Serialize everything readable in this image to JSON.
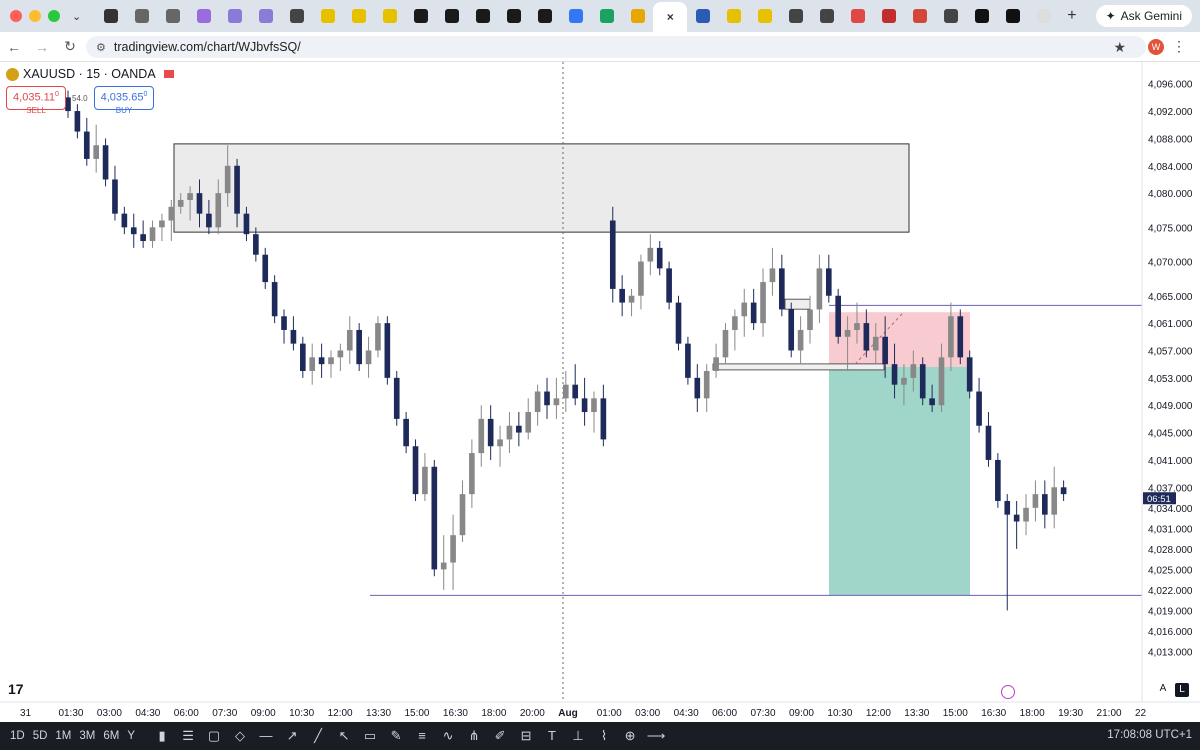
{
  "browser": {
    "url": "tradingview.com/chart/WJbvfsSQ/",
    "ask_gemini": "Ask Gemini",
    "profile_initial": "W",
    "tabs": [
      {
        "name": "tab-copilot",
        "color": "#333"
      },
      {
        "name": "tab-1",
        "color": "#666"
      },
      {
        "name": "tab-2",
        "color": "#666"
      },
      {
        "name": "tab-3",
        "color": "#9a6adf"
      },
      {
        "name": "tab-4",
        "color": "#8a7bd8"
      },
      {
        "name": "tab-5",
        "color": "#8a7bd8"
      },
      {
        "name": "tab-chrome-1",
        "color": "#444"
      },
      {
        "name": "tab-ex-1",
        "color": "#e7c100"
      },
      {
        "name": "tab-ex-2",
        "color": "#e7c100"
      },
      {
        "name": "tab-ex-3",
        "color": "#e7c100"
      },
      {
        "name": "tab-p-1",
        "color": "#1a1a1a"
      },
      {
        "name": "tab-p-2",
        "color": "#1a1a1a"
      },
      {
        "name": "tab-p-3",
        "color": "#1a1a1a"
      },
      {
        "name": "tab-p-4",
        "color": "#1a1a1a"
      },
      {
        "name": "tab-p-5",
        "color": "#1a1a1a"
      },
      {
        "name": "tab-play-1",
        "color": "#3477f5"
      },
      {
        "name": "tab-play-2",
        "color": "#1aa260"
      },
      {
        "name": "tab-bell",
        "color": "#e6a800"
      },
      {
        "name": "tab-tradingview-active",
        "color": "#fff"
      },
      {
        "name": "tab-chart",
        "color": "#2c5bb5"
      },
      {
        "name": "tab-ex-4",
        "color": "#e7c100"
      },
      {
        "name": "tab-ex-5",
        "color": "#e7c100"
      },
      {
        "name": "tab-chrome-2",
        "color": "#444"
      },
      {
        "name": "tab-chrome-3",
        "color": "#444"
      },
      {
        "name": "tab-d",
        "color": "#e04848"
      },
      {
        "name": "tab-x",
        "color": "#c02e2e"
      },
      {
        "name": "tab-gmail",
        "color": "#d44638"
      },
      {
        "name": "tab-chrome-4",
        "color": "#444"
      },
      {
        "name": "tab-black-1",
        "color": "#111"
      },
      {
        "name": "tab-black-2",
        "color": "#111"
      },
      {
        "name": "tab-fn",
        "color": "#ddd"
      }
    ]
  },
  "symbol": {
    "name": "XAUUSD · 15 · OANDA",
    "sell_price": "4,035.11",
    "sell_sup": "0",
    "sell_label": "SELL",
    "buy_price": "4,035.65",
    "buy_sup": "0",
    "buy_label": "BUY",
    "spread": "54.0"
  },
  "price_scale": {
    "labels": [
      "4,096.000",
      "4,092.000",
      "4,088.000",
      "4,084.000",
      "4,080.000",
      "4,075.000",
      "4,070.000",
      "4,065.000",
      "4,061.000",
      "4,057.000",
      "4,053.000",
      "4,049.000",
      "4,045.000",
      "4,041.000",
      "4,037.000",
      "4,034.000",
      "4,031.000",
      "4,028.000",
      "4,025.000",
      "4,022.000",
      "4,019.000",
      "4,016.000",
      "4,013.000"
    ],
    "countdown": "06:51"
  },
  "time_axis": {
    "labels": [
      "31",
      "01:30",
      "03:00",
      "04:30",
      "06:00",
      "07:30",
      "09:00",
      "10:30",
      "12:00",
      "13:30",
      "15:00",
      "16:30",
      "18:00",
      "20:00",
      "Aug",
      "01:00",
      "03:00",
      "04:30",
      "06:00",
      "07:30",
      "09:00",
      "10:30",
      "12:00",
      "13:30",
      "15:00",
      "16:30",
      "18:00",
      "19:30",
      "21:00",
      "22"
    ]
  },
  "chart_data": {
    "type": "candlestick",
    "symbol": "XAUUSD",
    "interval": "15",
    "broker": "OANDA",
    "ylim": [
      4010,
      4098
    ],
    "up_color": "#888888",
    "down_color": "#1e2a5a",
    "zones": {
      "supply_box": {
        "y_top": 4087.2,
        "y_bottom": 4074.3,
        "color": "#e6e6e6"
      },
      "stop_zone": {
        "y_top": 4062.6,
        "y_bottom": 4054.6,
        "color": "#f5b5bd"
      },
      "target_zone": {
        "y_top": 4054.6,
        "y_bottom": 4021.2,
        "color": "#8fcfbf"
      },
      "support_line": 4021.2,
      "resistance_line": 4063.6
    },
    "candles": [
      [
        4094,
        4095,
        4091,
        4092
      ],
      [
        4092,
        4093,
        4088,
        4089
      ],
      [
        4089,
        4091,
        4084,
        4085
      ],
      [
        4085,
        4090,
        4083,
        4087
      ],
      [
        4087,
        4088,
        4081,
        4082
      ],
      [
        4082,
        4084,
        4076,
        4077
      ],
      [
        4077,
        4078,
        4074,
        4075
      ],
      [
        4075,
        4077,
        4072,
        4074
      ],
      [
        4074,
        4076,
        4072,
        4073
      ],
      [
        4073,
        4076,
        4072,
        4075
      ],
      [
        4075,
        4077,
        4073,
        4076
      ],
      [
        4076,
        4079,
        4073,
        4078
      ],
      [
        4078,
        4080,
        4077,
        4079
      ],
      [
        4079,
        4081,
        4076,
        4080
      ],
      [
        4080,
        4082,
        4075,
        4077
      ],
      [
        4077,
        4079,
        4074,
        4075
      ],
      [
        4075,
        4082,
        4074,
        4080
      ],
      [
        4080,
        4087,
        4078,
        4084
      ],
      [
        4084,
        4085,
        4075,
        4077
      ],
      [
        4077,
        4078,
        4073,
        4074
      ],
      [
        4074,
        4075,
        4070,
        4071
      ],
      [
        4071,
        4072,
        4066,
        4067
      ],
      [
        4067,
        4068,
        4061,
        4062
      ],
      [
        4062,
        4063,
        4058,
        4060
      ],
      [
        4060,
        4062,
        4057,
        4058
      ],
      [
        4058,
        4059,
        4053,
        4054
      ],
      [
        4054,
        4058,
        4052,
        4056
      ],
      [
        4056,
        4058,
        4053,
        4055
      ],
      [
        4055,
        4057,
        4053,
        4056
      ],
      [
        4056,
        4058,
        4054,
        4057
      ],
      [
        4057,
        4062,
        4055,
        4060
      ],
      [
        4060,
        4061,
        4054,
        4055
      ],
      [
        4055,
        4059,
        4053,
        4057
      ],
      [
        4057,
        4062,
        4056,
        4061
      ],
      [
        4061,
        4062,
        4052,
        4053
      ],
      [
        4053,
        4054,
        4046,
        4047
      ],
      [
        4047,
        4048,
        4042,
        4043
      ],
      [
        4043,
        4044,
        4035,
        4036
      ],
      [
        4036,
        4042,
        4035,
        4040
      ],
      [
        4040,
        4041,
        4024,
        4025
      ],
      [
        4025,
        4030,
        4022,
        4026
      ],
      [
        4026,
        4033,
        4022,
        4030
      ],
      [
        4030,
        4038,
        4029,
        4036
      ],
      [
        4036,
        4044,
        4034,
        4042
      ],
      [
        4042,
        4049,
        4040,
        4047
      ],
      [
        4047,
        4049,
        4041,
        4043
      ],
      [
        4043,
        4046,
        4040,
        4044
      ],
      [
        4044,
        4048,
        4042,
        4046
      ],
      [
        4046,
        4048,
        4043,
        4045
      ],
      [
        4045,
        4050,
        4044,
        4048
      ],
      [
        4048,
        4052,
        4046,
        4051
      ],
      [
        4051,
        4053,
        4047,
        4049
      ],
      [
        4049,
        4053,
        4047,
        4050
      ],
      [
        4050,
        4054,
        4048,
        4052
      ],
      [
        4052,
        4055,
        4049,
        4050
      ],
      [
        4050,
        4053,
        4046,
        4048
      ],
      [
        4048,
        4051,
        4045,
        4050
      ],
      [
        4050,
        4052,
        4043,
        4044
      ],
      [
        4076,
        4078,
        4064,
        4066
      ],
      [
        4066,
        4068,
        4062,
        4064
      ],
      [
        4064,
        4066,
        4062,
        4065
      ],
      [
        4065,
        4071,
        4063,
        4070
      ],
      [
        4070,
        4074,
        4068,
        4072
      ],
      [
        4072,
        4073,
        4068,
        4069
      ],
      [
        4069,
        4070,
        4063,
        4064
      ],
      [
        4064,
        4065,
        4057,
        4058
      ],
      [
        4058,
        4059,
        4052,
        4053
      ],
      [
        4053,
        4055,
        4048,
        4050
      ],
      [
        4050,
        4055,
        4048,
        4054
      ],
      [
        4054,
        4058,
        4053,
        4056
      ],
      [
        4056,
        4061,
        4055,
        4060
      ],
      [
        4060,
        4063,
        4057,
        4062
      ],
      [
        4062,
        4066,
        4059,
        4064
      ],
      [
        4064,
        4066,
        4060,
        4061
      ],
      [
        4061,
        4069,
        4059,
        4067
      ],
      [
        4067,
        4072,
        4065,
        4069
      ],
      [
        4069,
        4071,
        4062,
        4063
      ],
      [
        4063,
        4064,
        4056,
        4057
      ],
      [
        4057,
        4062,
        4055,
        4060
      ],
      [
        4060,
        4065,
        4058,
        4063
      ],
      [
        4063,
        4071,
        4061,
        4069
      ],
      [
        4069,
        4071,
        4064,
        4065
      ],
      [
        4065,
        4066,
        4058,
        4059
      ],
      [
        4059,
        4062,
        4054,
        4060
      ],
      [
        4060,
        4064,
        4058,
        4061
      ],
      [
        4061,
        4063,
        4056,
        4057
      ],
      [
        4057,
        4061,
        4055,
        4059
      ],
      [
        4059,
        4062,
        4053,
        4055
      ],
      [
        4055,
        4058,
        4050,
        4052
      ],
      [
        4052,
        4055,
        4049,
        4053
      ],
      [
        4053,
        4057,
        4051,
        4055
      ],
      [
        4055,
        4056,
        4049,
        4050
      ],
      [
        4050,
        4052,
        4048,
        4049
      ],
      [
        4049,
        4058,
        4048,
        4056
      ],
      [
        4056,
        4064,
        4054,
        4062
      ],
      [
        4062,
        4063,
        4055,
        4056
      ],
      [
        4056,
        4057,
        4050,
        4051
      ],
      [
        4051,
        4053,
        4045,
        4046
      ],
      [
        4046,
        4048,
        4040,
        4041
      ],
      [
        4041,
        4042,
        4034,
        4035
      ],
      [
        4035,
        4036,
        4019,
        4033
      ],
      [
        4033,
        4035,
        4028,
        4032
      ],
      [
        4032,
        4036,
        4030,
        4034
      ],
      [
        4034,
        4038,
        4032,
        4036
      ],
      [
        4036,
        4038,
        4031,
        4033
      ],
      [
        4033,
        4040,
        4031,
        4037
      ],
      [
        4037,
        4038,
        4035,
        4036
      ]
    ]
  },
  "bottom_bar": {
    "ranges": [
      "1D",
      "5D",
      "1M",
      "3M",
      "6M",
      "Y"
    ],
    "clock": "17:08:08 UTC+1"
  }
}
